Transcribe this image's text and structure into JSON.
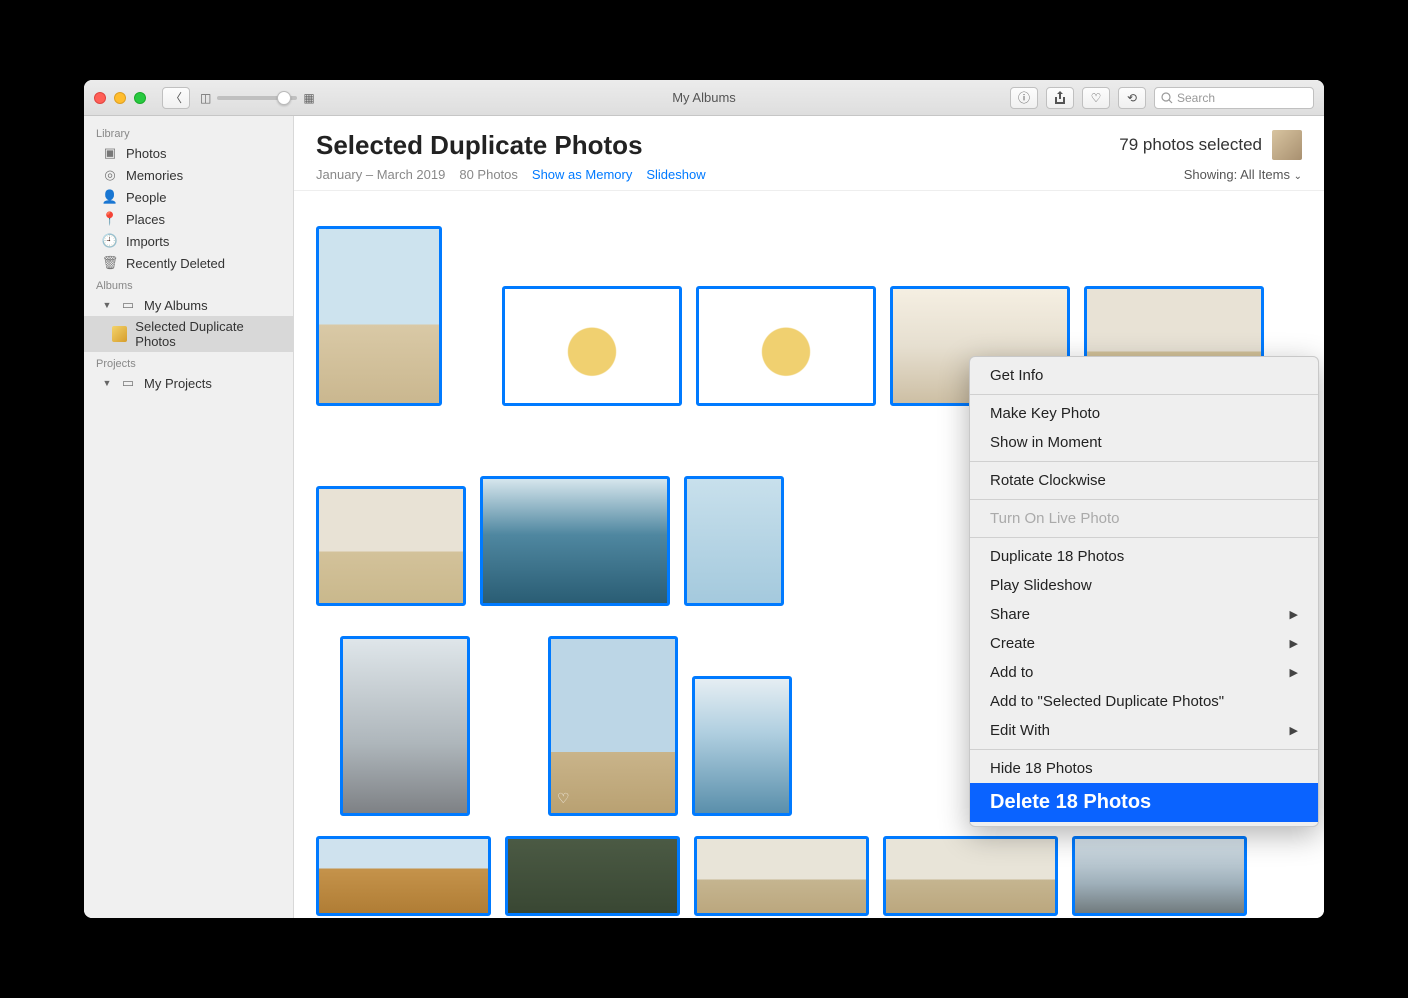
{
  "titlebar": {
    "title": "My Albums",
    "search_placeholder": "Search"
  },
  "sidebar": {
    "sections": {
      "library": "Library",
      "albums": "Albums",
      "projects": "Projects"
    },
    "library_items": {
      "photos": "Photos",
      "memories": "Memories",
      "people": "People",
      "places": "Places",
      "imports": "Imports",
      "recently_deleted": "Recently Deleted"
    },
    "albums_items": {
      "my_albums": "My Albums",
      "selected_duplicates": "Selected Duplicate Photos"
    },
    "projects_items": {
      "my_projects": "My Projects"
    }
  },
  "header": {
    "title": "Selected Duplicate Photos",
    "selected": "79 photos selected",
    "date_range": "January – March 2019",
    "count": "80 Photos",
    "show_memory": "Show as Memory",
    "slideshow": "Slideshow",
    "showing_label": "Showing:",
    "showing_value": "All Items"
  },
  "context_menu": {
    "get_info": "Get Info",
    "make_key": "Make Key Photo",
    "show_moment": "Show in Moment",
    "rotate": "Rotate Clockwise",
    "live_photo": "Turn On Live Photo",
    "duplicate": "Duplicate 18 Photos",
    "play_slideshow": "Play Slideshow",
    "share": "Share",
    "create": "Create",
    "add_to": "Add to",
    "add_to_album": "Add to \"Selected Duplicate Photos\"",
    "edit_with": "Edit With",
    "hide": "Hide 18 Photos",
    "delete": "Delete 18 Photos"
  }
}
